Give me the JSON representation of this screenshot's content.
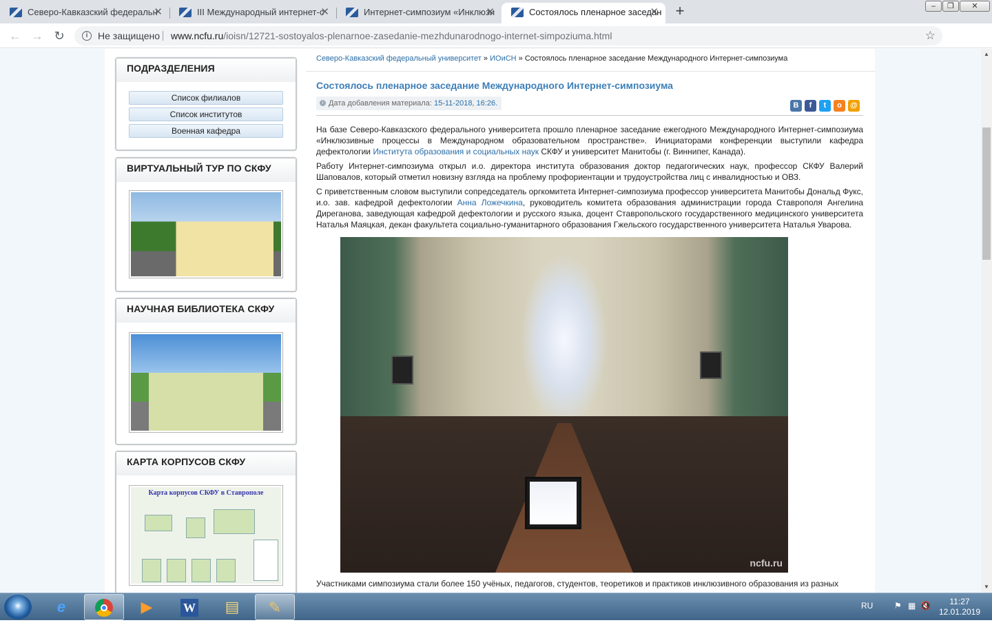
{
  "tabs": [
    {
      "title": "Северо-Кавказский федеральн"
    },
    {
      "title": "III Международный интернет-с"
    },
    {
      "title": "Интернет-симпозиум «Инклюзи"
    },
    {
      "title": "Состоялось пленарное заседан"
    }
  ],
  "address_bar": {
    "security_label": "Не защищено",
    "domain": "www.ncfu.ru",
    "path": "/ioisn/12721-sostoyalos-plenarnoe-zasedanie-mezhdunarodnogo-internet-simpoziuma.html"
  },
  "sidebar": {
    "subdivisions": {
      "title": "Подразделения",
      "links": [
        "Список филиалов",
        "Список институтов",
        "Военная кафедра"
      ]
    },
    "virtual_tour": {
      "title": "Виртуальный тур по СКФУ"
    },
    "library": {
      "title": "Научная библиотека СКФУ"
    },
    "campus_map": {
      "title": "Карта корпусов СКФУ",
      "image_caption": "Карта корпусов СКФУ в Ставрополе"
    }
  },
  "breadcrumb": {
    "items": [
      "Северо-Кавказский федеральный университет",
      "ИОиСН"
    ],
    "current": "Состоялось пленарное заседание Международного Интернет-симпозиума",
    "separator": "»"
  },
  "article": {
    "title": "Состоялось пленарное заседание Международного Интернет-симпозиума",
    "date_label": "Дата добавления материала:",
    "date_value": "15-11-2018, 16:26.",
    "p1_a": "На базе Северо-Кавказского федерального университета прошло пленарное заседание ежегодного Международного Интернет-симпозиума «Инклюзивные процессы в Международном образовательном пространстве». Инициаторами конференции выступили кафедра дефектологии ",
    "p1_link": "Института образования и социальных наук",
    "p1_b": " СКФУ и университет Манитобы (г. Виннипег, Канада).",
    "p2": "Работу Интернет-симпозиума открыл и.о. директора института образования доктор педагогических наук, профессор СКФУ Валерий Шаповалов, который отметил новизну взгляда на проблему профориентации и трудоустройства лиц с инвалидностью и ОВЗ.",
    "p3_a": "С приветственным словом выступили сопредседатель оргкомитета Интернет-симпозиума профессор университета Манитобы Дональд Фукс, и.о. зав. кафедрой дефектологии ",
    "p3_link": "Анна Ложечкина",
    "p3_b": ", руководитель комитета образования администрации города Ставрополя Ангелина Диреганова, заведующая кафедрой дефектологии и русского языка, доцент Ставропольского государственного медицинского университета Наталья Маяцкая, декан факультета социально-гуманитарного образования Гжельского государственного университета Наталья Уварова.",
    "photo_watermark": "ncfu.ru",
    "p4": "Участниками симпозиума стали более 150 учёных, педагогов, студентов, теоретиков и практиков инклюзивного образования из разных"
  },
  "share_icons": [
    {
      "name": "vk-icon",
      "glyph": "B",
      "color": "#4a76a8"
    },
    {
      "name": "facebook-icon",
      "glyph": "f",
      "color": "#3b5998"
    },
    {
      "name": "twitter-icon",
      "glyph": "t",
      "color": "#1da1f2"
    },
    {
      "name": "odnoklassniki-icon",
      "glyph": "o",
      "color": "#f58220"
    },
    {
      "name": "mailru-icon",
      "glyph": "@",
      "color": "#f2a000"
    }
  ],
  "taskbar": {
    "language": "RU",
    "time": "11:27",
    "date": "12.01.2019"
  }
}
